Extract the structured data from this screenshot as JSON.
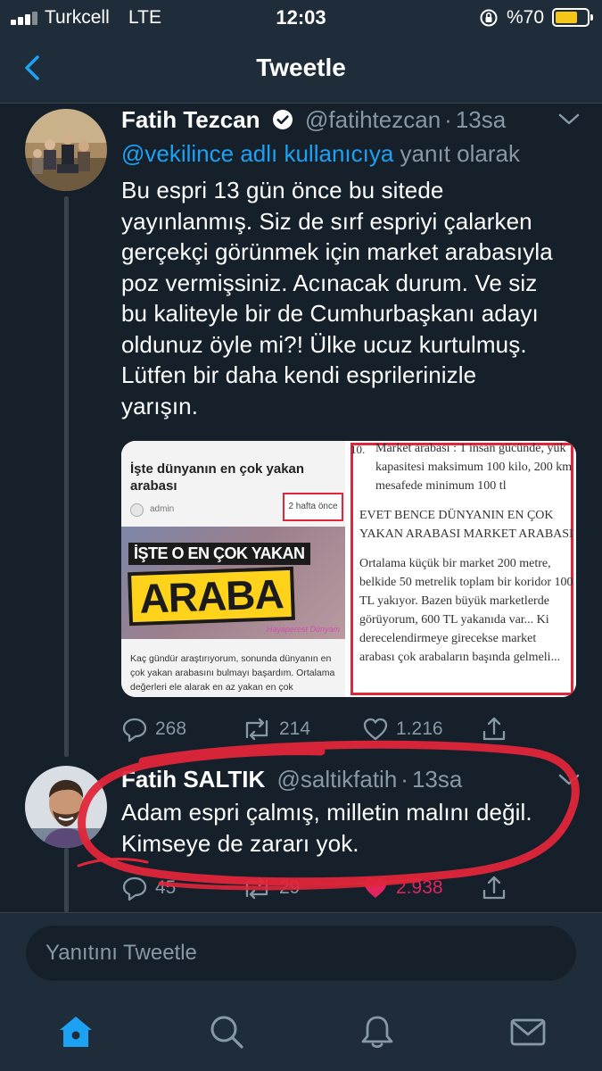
{
  "status_bar": {
    "carrier": "Turkcell",
    "network": "LTE",
    "time": "12:03",
    "battery": "%70",
    "battery_level": 0.7,
    "battery_color": "#f5c518"
  },
  "header": {
    "title": "Tweetle",
    "back_icon": "chevron-left-icon"
  },
  "tweets": [
    {
      "name": "Fatih Tezcan",
      "verified": true,
      "handle": "@fatihtezcan",
      "dot": "·",
      "time": "13sa",
      "reply_to": "@vekilince adlı kullanıcıya",
      "reply_suffix": "yanıt olarak",
      "text": "Bu espri 13 gün önce bu sitede\nyayınlanmış. Siz de sırf espriyi çalarken\ngerçekçi görünmek için market arabasıyla\npoz vermişsiniz. Acınacak durum. Ve siz\nbu kaliteyle bir de Cumhurbaşkanı adayı\noldunuz öyle mi?! Ülke ucuz kurtulmuş.\nLütfen bir daha kendi esprilerinizle\nyarışın.",
      "media": {
        "left": {
          "title": "İşte dünyanın en çok yakan arabası",
          "author": "admin",
          "date": "2 hafta önce",
          "banner_top": "İŞTE O EN ÇOK YAKAN",
          "banner_big": "ARABA",
          "banner_sign": "Hayaperest Dünyam",
          "body": "Kaç gündür araştırıyorum, sonunda dünyanın en çok yakan arabasını bulmayı başardım. Ortalama değerleri ele alarak en az yakan en çok"
        },
        "right": {
          "number": "10.",
          "p1": "Market arabası : 1 insan gücünde, yük kapasitesi maksimum 100 kilo, 200 km mesafede minimum 100 tl",
          "p2": "EVET BENCE DÜNYANIN EN ÇOK YAKAN ARABASI MARKET ARABASI",
          "p3": "Ortalama küçük bir market 200 metre, belkide 50 metrelik toplam bir koridor 100 TL yakıyor. Bazen büyük marketlerde görüyorum, 600 TL yakanıda var... Ki derecelendirmeye girecekse market arabası çok arabaların başında gelmeli..."
        }
      },
      "actions": {
        "replies": "268",
        "retweets": "214",
        "likes": "1.216"
      }
    },
    {
      "name": "Fatih SALTIK",
      "handle": "@saltikfatih",
      "dot": "·",
      "time": "13sa",
      "text": "Adam espri çalmış, milletin malını değil.\nKimseye de zararı yok.",
      "actions": {
        "replies": "45",
        "retweets": "29",
        "likes": "2.938"
      },
      "liked": true
    }
  ],
  "reply_box": {
    "placeholder": "Yanıtını Tweetle"
  },
  "tabs": [
    {
      "icon": "home-icon",
      "active": true
    },
    {
      "icon": "search-icon",
      "active": false
    },
    {
      "icon": "bell-icon",
      "active": false
    },
    {
      "icon": "mail-icon",
      "active": false
    }
  ],
  "colors": {
    "background": "#15202b",
    "bar": "#1f2d3b",
    "accent": "#1da1f2",
    "muted": "#8899a6",
    "like": "#e0245e",
    "annotation": "#e0263a"
  }
}
